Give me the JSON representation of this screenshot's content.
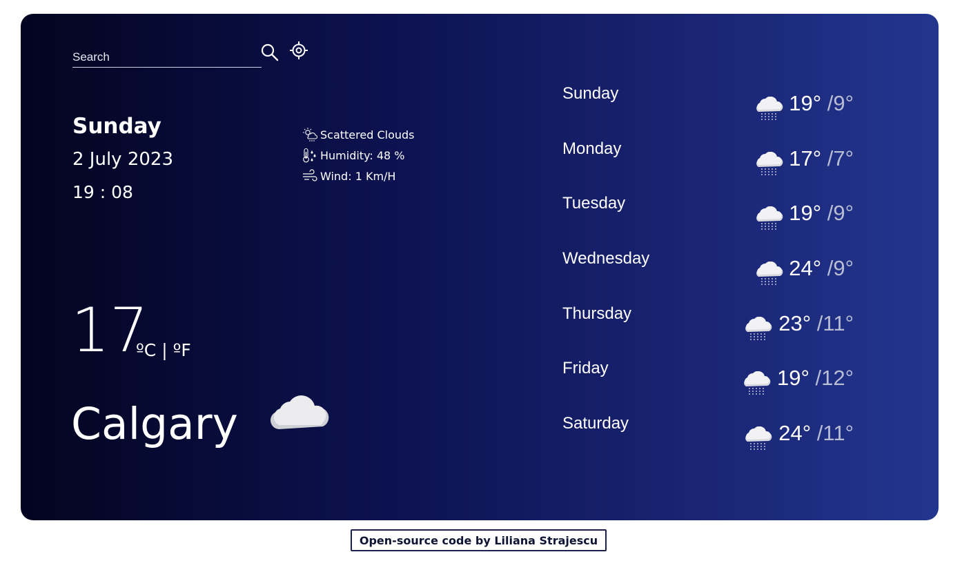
{
  "search": {
    "placeholder": "Search"
  },
  "current": {
    "day": "Sunday",
    "date": "2 July 2023",
    "time": "19 : 08",
    "description": "Scattered Clouds",
    "humidity": "Humidity: 48 %",
    "wind": "Wind: 1 Km/H",
    "temperature": "17",
    "unit_c": "ºC",
    "unit_sep": " | ",
    "unit_f": "ºF",
    "city": "Calgary",
    "icon": "cloud-icon"
  },
  "forecast": [
    {
      "day": "Sunday",
      "max": "19°",
      "min": " /9°",
      "icon": "rain-cloud-icon"
    },
    {
      "day": "Monday",
      "max": "17°",
      "min": " /7°",
      "icon": "rain-cloud-icon"
    },
    {
      "day": "Tuesday",
      "max": "19°",
      "min": " /9°",
      "icon": "rain-cloud-icon"
    },
    {
      "day": "Wednesday",
      "max": "24°",
      "min": " /9°",
      "icon": "rain-cloud-icon"
    },
    {
      "day": "Thursday",
      "max": "23°",
      "min": " /11°",
      "icon": "rain-cloud-icon"
    },
    {
      "day": "Friday",
      "max": "19°",
      "min": " /12°",
      "icon": "rain-cloud-icon"
    },
    {
      "day": "Saturday",
      "max": "24°",
      "min": " /11°",
      "icon": "rain-cloud-icon"
    }
  ],
  "footer": {
    "label": "Open-source code by Liliana Strajescu"
  },
  "colors": {
    "gradient_start": "#03041f",
    "gradient_end": "#22368f",
    "footer_border": "#1a1f4d"
  }
}
